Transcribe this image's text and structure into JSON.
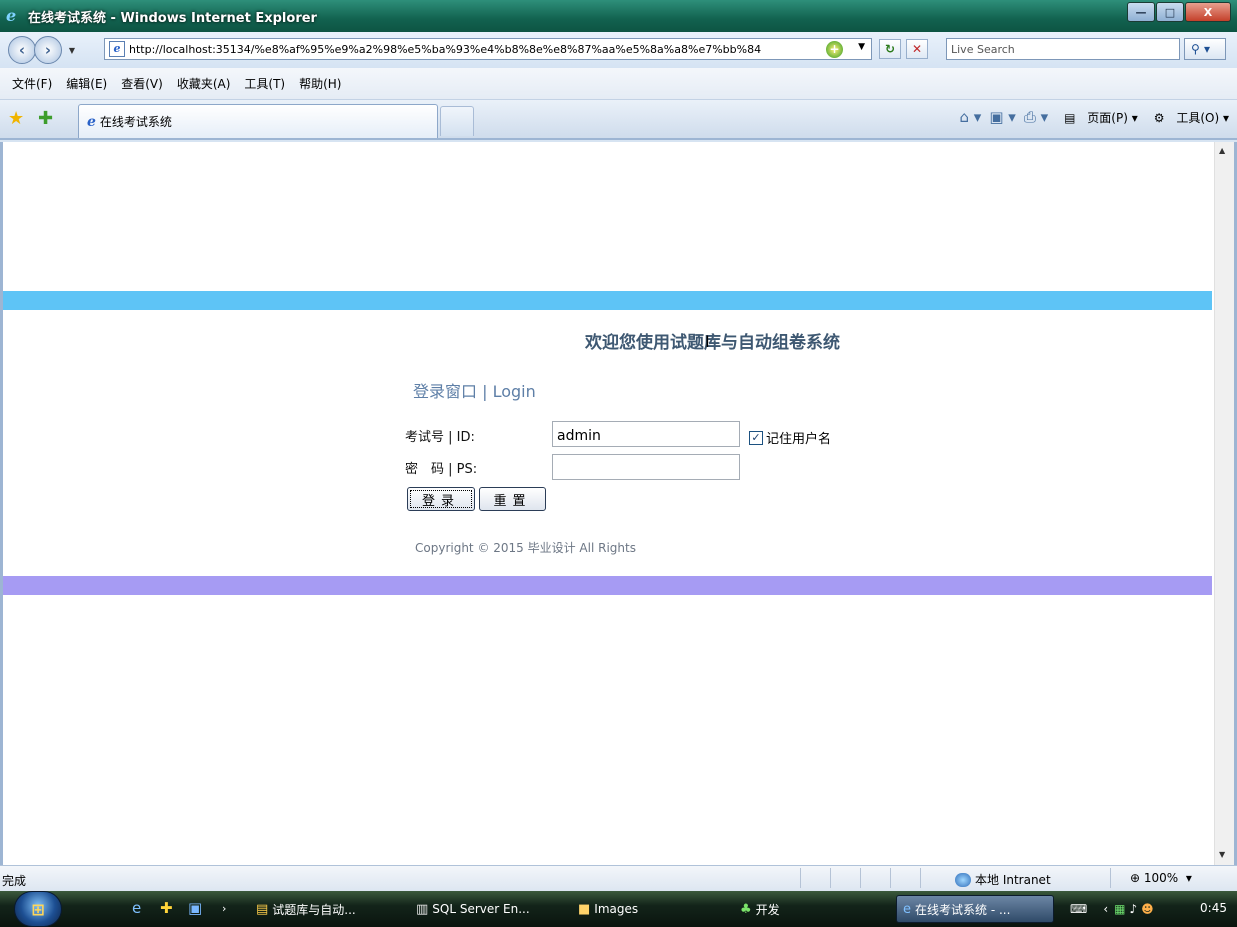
{
  "window": {
    "title": "在线考试系统 - Windows Internet Explorer",
    "btn_min": "—",
    "btn_max": "□",
    "btn_close": "X"
  },
  "address": {
    "url": "http://localhost:35134/%e8%af%95%e9%a2%98%e5%ba%93%e4%b8%8e%e8%87%aa%e5%8a%a8%e7%bb%84",
    "search_placeholder": "Live Search"
  },
  "menu": {
    "items": [
      "文件(F)",
      "编辑(E)",
      "查看(V)",
      "收藏夹(A)",
      "工具(T)",
      "帮助(H)"
    ]
  },
  "tabs": {
    "active_label": "在线考试系统"
  },
  "commandbar": {
    "page_label": "页面(P)",
    "tools_label": "工具(O)"
  },
  "page": {
    "welcome": "欢迎您使用试题库与自动组卷系统",
    "login_title": "登录窗口 | Login",
    "id_label": "考试号 | ID:",
    "id_value": "admin",
    "ps_label": "密　码 | PS:",
    "ps_value": "",
    "remember_label": "记住用户名",
    "remember_checked": true,
    "login_button": "登录",
    "reset_button": "重置",
    "copyright": "Copyright © 2015 毕业设计  All Rights"
  },
  "status": {
    "text": "完成",
    "zone": "本地 Intranet",
    "zoom": "100%"
  },
  "taskbar": {
    "tasks": [
      {
        "label": "试题库与自动...",
        "icon": "folder-app-icon"
      },
      {
        "label": "SQL Server En...",
        "icon": "sql-server-icon"
      },
      {
        "label": "Images",
        "icon": "folder-icon"
      },
      {
        "label": "开发",
        "icon": "tree-icon"
      },
      {
        "label": "在线考试系统 - ...",
        "icon": "ie-icon"
      }
    ],
    "clock": "0:45"
  }
}
